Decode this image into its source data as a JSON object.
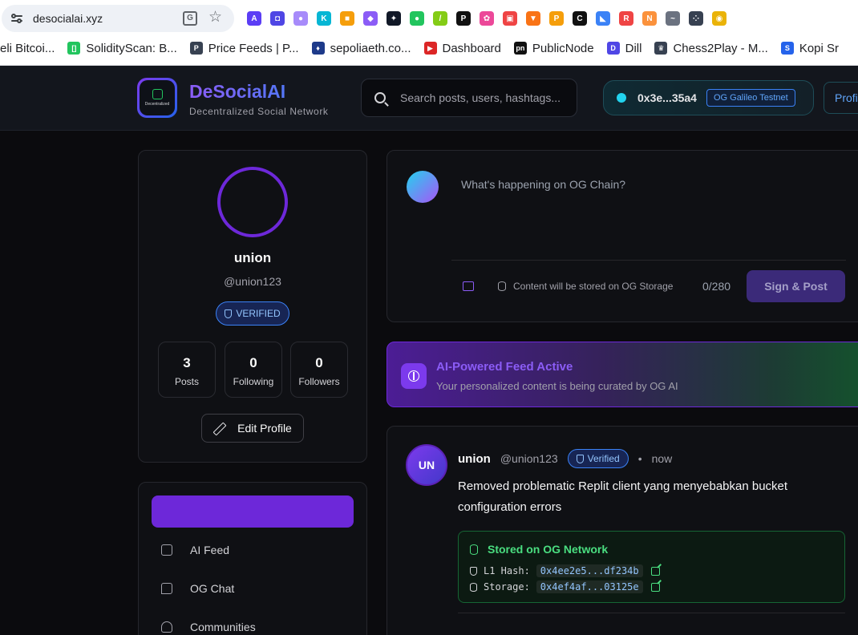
{
  "browser": {
    "url": "desocialai.xyz",
    "extensions": [
      {
        "icon": "a-ext-icon",
        "color": "#5b3df5",
        "glyph": "A"
      },
      {
        "icon": "sq-ext-icon",
        "color": "#4f46e5",
        "glyph": "◘"
      },
      {
        "icon": "ghost-ext-icon",
        "color": "#a78bfa",
        "glyph": "●"
      },
      {
        "icon": "k-ext-icon",
        "color": "#06b6d4",
        "glyph": "K"
      },
      {
        "icon": "box-ext-icon",
        "color": "#f59e0b",
        "glyph": "■"
      },
      {
        "icon": "cat-ext-icon",
        "color": "#8b5cf6",
        "glyph": "◆"
      },
      {
        "icon": "spark-ext-icon",
        "color": "#111827",
        "glyph": "✦"
      },
      {
        "icon": "frog-ext-icon",
        "color": "#22c55e",
        "glyph": "●"
      },
      {
        "icon": "leaf-ext-icon",
        "color": "#84cc16",
        "glyph": "/"
      },
      {
        "icon": "p-ext-icon",
        "color": "#111111",
        "glyph": "P"
      },
      {
        "icon": "paw-ext-icon",
        "color": "#ec4899",
        "glyph": "✿"
      },
      {
        "icon": "bot-ext-icon",
        "color": "#ef4444",
        "glyph": "▣"
      },
      {
        "icon": "fox-ext-icon",
        "color": "#f97316",
        "glyph": "▼"
      },
      {
        "icon": "coin-ext-icon",
        "color": "#f59e0b",
        "glyph": "P"
      },
      {
        "icon": "c-ext-icon",
        "color": "#111111",
        "glyph": "C"
      },
      {
        "icon": "bird-ext-icon",
        "color": "#3b82f6",
        "glyph": "◣"
      },
      {
        "icon": "r-ext-icon",
        "color": "#ef4444",
        "glyph": "R"
      },
      {
        "icon": "n-ext-icon",
        "color": "#fb923c",
        "glyph": "N"
      },
      {
        "icon": "wave-ext-icon",
        "color": "#6b7280",
        "glyph": "~"
      },
      {
        "icon": "dots-ext-icon",
        "color": "#374151",
        "glyph": "⁘"
      },
      {
        "icon": "smile-ext-icon",
        "color": "#eab308",
        "glyph": "◉"
      }
    ],
    "bookmarks": [
      {
        "label": "eli Bitcoi...",
        "color": "#f59e0b",
        "icon": "bitcoin-bookmark-icon",
        "fav": ""
      },
      {
        "label": "SolidityScan: B...",
        "color": "#22c55e",
        "icon": "solidityscan-bookmark-icon",
        "fav": "[]"
      },
      {
        "label": "Price Feeds | P...",
        "color": "#374151",
        "icon": "pyth-bookmark-icon",
        "fav": "P"
      },
      {
        "label": "sepoliaeth.co...",
        "color": "#1e3a8a",
        "icon": "ethereum-bookmark-icon",
        "fav": "♦"
      },
      {
        "label": "Dashboard",
        "color": "#dc2626",
        "icon": "dashboard-bookmark-icon",
        "fav": "▶"
      },
      {
        "label": "PublicNode",
        "color": "#111111",
        "icon": "publicnode-bookmark-icon",
        "fav": "pn"
      },
      {
        "label": "Dill",
        "color": "#4f46e5",
        "icon": "dill-bookmark-icon",
        "fav": "D"
      },
      {
        "label": "Chess2Play - M...",
        "color": "#374151",
        "icon": "chess-bookmark-icon",
        "fav": "♛"
      },
      {
        "label": "Kopi Sr",
        "color": "#2563eb",
        "icon": "kopi-bookmark-icon",
        "fav": "S"
      }
    ]
  },
  "header": {
    "logo_text": "Decentralized",
    "brand_name": "DeSocialAI",
    "tagline": "Decentralized Social Network",
    "search_placeholder": "Search posts, users, hashtags...",
    "wallet_address": "0x3e...35a4",
    "network": "OG Galileo Testnet",
    "profile_label": "Profi"
  },
  "profile": {
    "name": "union",
    "handle": "@union123",
    "verified_label": "VERIFIED",
    "stats": [
      {
        "value": "3",
        "label": "Posts"
      },
      {
        "value": "0",
        "label": "Following"
      },
      {
        "value": "0",
        "label": "Followers"
      }
    ],
    "edit_label": "Edit Profile"
  },
  "nav": {
    "items": [
      {
        "label": "AI Feed"
      },
      {
        "label": "OG Chat"
      },
      {
        "label": "Communities"
      }
    ]
  },
  "composer": {
    "placeholder": "What's happening on OG Chain?",
    "storage_note": "Content will be stored on OG Storage",
    "char_count": "0/280",
    "post_label": "Sign & Post"
  },
  "ai_banner": {
    "title": "AI-Powered Feed Active",
    "subtitle": "Your personalized content is being curated by OG AI"
  },
  "post": {
    "avatar_initials": "UN",
    "author": "union",
    "handle": "@union123",
    "verified_label": "Verified",
    "separator": "•",
    "time": "now",
    "body": "Removed problematic Replit client yang menyebabkan bucket configuration errors",
    "storage_title": "Stored on OG Network",
    "l1_label": "L1 Hash:",
    "l1_hash": "0x4ee2e5...df234b",
    "storage_label": "Storage:",
    "storage_hash": "0x4ef4af...03125e"
  }
}
